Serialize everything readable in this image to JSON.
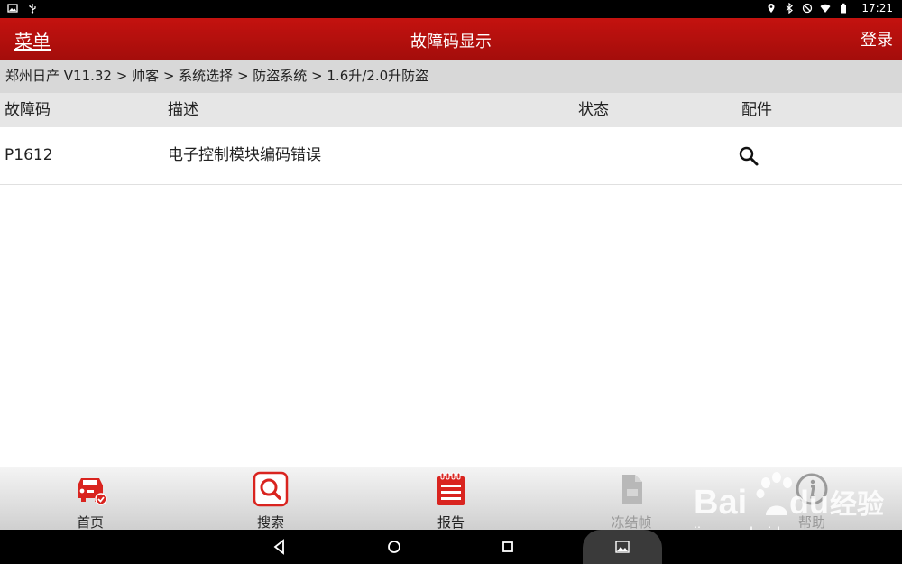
{
  "status_bar": {
    "time": "17:21",
    "left_icons": [
      "image-icon",
      "usb-icon"
    ],
    "right_icons": [
      "location-icon",
      "bluetooth-icon",
      "blocked-icon",
      "wifi-icon",
      "battery-icon"
    ]
  },
  "header": {
    "menu_label": "菜单",
    "title": "故障码显示",
    "login_label": "登录",
    "bg_color": "#b30f0d"
  },
  "breadcrumb": "郑州日产 V11.32 > 帅客 > 系统选择 > 防盗系统 > 1.6升/2.0升防盗",
  "table": {
    "columns": [
      "故障码",
      "描述",
      "状态",
      "配件"
    ],
    "rows": [
      {
        "code": "P1612",
        "description": "电子控制模块编码错误",
        "status": "",
        "parts_icon": "search-icon"
      }
    ]
  },
  "toolbar": {
    "items": [
      {
        "label": "首页",
        "icon": "car-home-icon",
        "enabled": true
      },
      {
        "label": "搜索",
        "icon": "search-icon",
        "enabled": true
      },
      {
        "label": "报告",
        "icon": "report-icon",
        "enabled": true
      },
      {
        "label": "冻结帧",
        "icon": "freeze-frame-icon",
        "enabled": false
      },
      {
        "label": "帮助",
        "icon": "info-icon",
        "enabled": false
      }
    ],
    "accent_color": "#d9241f"
  },
  "nav_bar": {
    "buttons": [
      "back-icon",
      "home-icon",
      "recents-icon",
      "screenshot-icon"
    ]
  },
  "watermark": {
    "brand": "Bai du 经验",
    "url": "jingyan.baidu.com"
  }
}
